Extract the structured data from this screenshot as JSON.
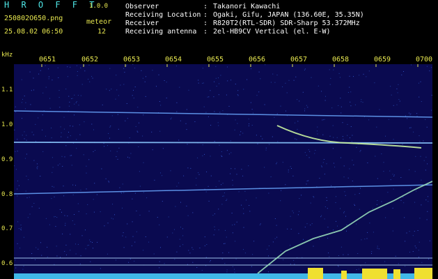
{
  "app": {
    "title": "H R O F F T",
    "version": "1.0.0"
  },
  "file": {
    "name": "250802O650.png",
    "datetime": "25.08.02 06:50"
  },
  "meteor": {
    "label": "meteor",
    "count": "12"
  },
  "info": [
    {
      "label": "Observer",
      "value": "Takanori Kawachi"
    },
    {
      "label": "Receiving Location",
      "value": "Ogaki, Gifu, JAPAN (136.60E, 35.35N)"
    },
    {
      "label": "Receiver",
      "value": "R820T2(RTL-SDR) SDR-Sharp 53.372MHz"
    },
    {
      "label": "Receiving antenna",
      "value": "2el-HB9CV Vertical (el. E-W)"
    }
  ],
  "separator": ":",
  "axis": {
    "unit": "kHz",
    "time_ticks": [
      "0651",
      "0652",
      "0653",
      "0654",
      "0655",
      "0656",
      "0657",
      "0658",
      "0659",
      "0700"
    ],
    "freq_ticks": [
      "1.1",
      "1.0",
      "0.9",
      "0.8",
      "0.7",
      "0.6"
    ]
  },
  "colors": {
    "background": "#0a0a50",
    "label": "#e8e850",
    "title": "#4fe8e8",
    "signal": "#a0e0ff"
  }
}
